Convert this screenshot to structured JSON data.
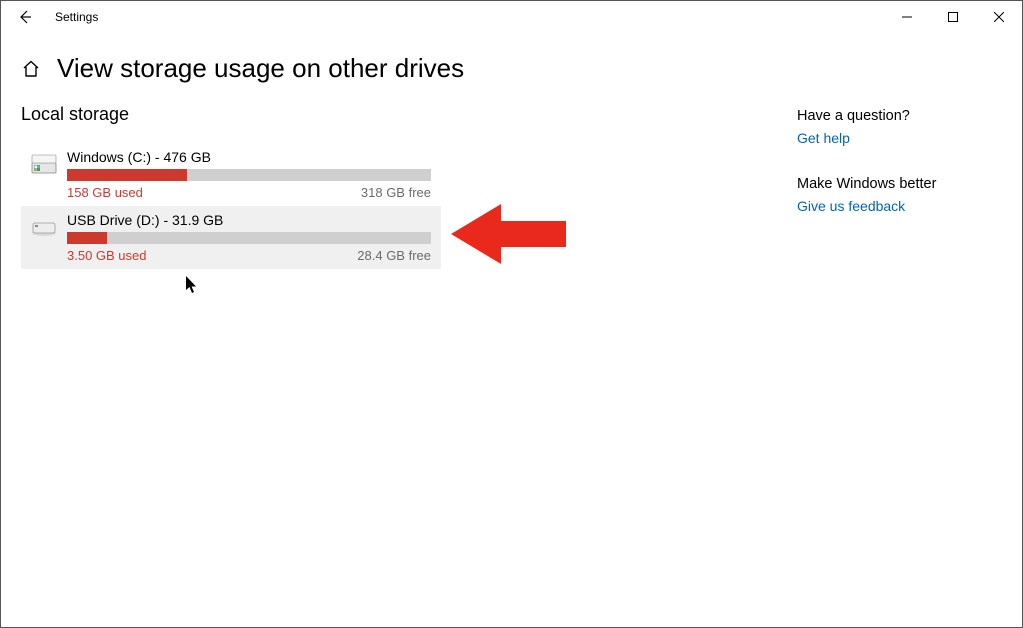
{
  "window": {
    "app_title": "Settings"
  },
  "page": {
    "title": "View storage usage on other drives",
    "section_title": "Local storage"
  },
  "drives": [
    {
      "name": "Windows (C:) - 476 GB",
      "used_text": "158 GB used",
      "free_text": "318 GB free",
      "fill_percent": 33,
      "selected": false
    },
    {
      "name": "USB Drive (D:) - 31.9 GB",
      "used_text": "3.50 GB used",
      "free_text": "28.4 GB free",
      "fill_percent": 11,
      "selected": true
    }
  ],
  "sidebar": {
    "question_heading": "Have a question?",
    "help_link": "Get help",
    "better_heading": "Make Windows better",
    "feedback_link": "Give us feedback"
  },
  "colors": {
    "accent": "#cc3a2e",
    "link": "#0066b4",
    "arrow": "#e8291c"
  }
}
